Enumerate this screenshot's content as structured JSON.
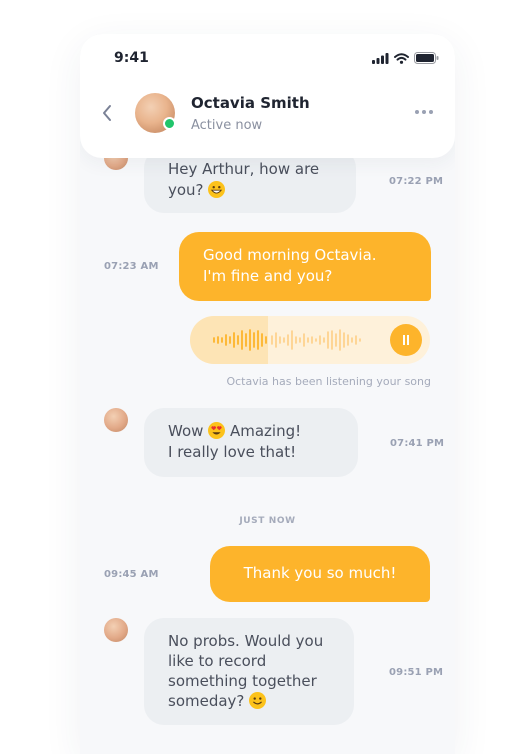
{
  "status_bar": {
    "time": "9:41"
  },
  "contact": {
    "name": "Octavia Smith",
    "status": "Active now"
  },
  "messages": [
    {
      "from": "them",
      "text_a": "Hey Arthur, how are",
      "text_b": "you?",
      "emoji": "grinning-face-emoji",
      "time": "07:22 PM"
    },
    {
      "from": "me",
      "text_a": "Good morning Octavia.",
      "text_b": "I'm fine and you?",
      "time": "07:23 AM"
    },
    {
      "from": "me",
      "type": "voice",
      "note": "Octavia has been listening your song"
    },
    {
      "from": "them",
      "text_a": "Wow",
      "emoji": "heart-eyes-emoji",
      "text_a2": "Amazing!",
      "text_b": "I really love that!",
      "time": "07:41 PM"
    },
    {
      "divider": "JUST NOW"
    },
    {
      "from": "me",
      "text": "Thank you so much!",
      "time": "09:45 AM"
    },
    {
      "from": "them",
      "lines": [
        "No probs. Would you",
        "like to record",
        "something together"
      ],
      "last": "someday?",
      "emoji": "smiling-face-emoji",
      "time": "09:51 PM"
    }
  ],
  "colors": {
    "accent": "#fdb42b",
    "incoming": "#eceff2",
    "online": "#21c56b"
  }
}
